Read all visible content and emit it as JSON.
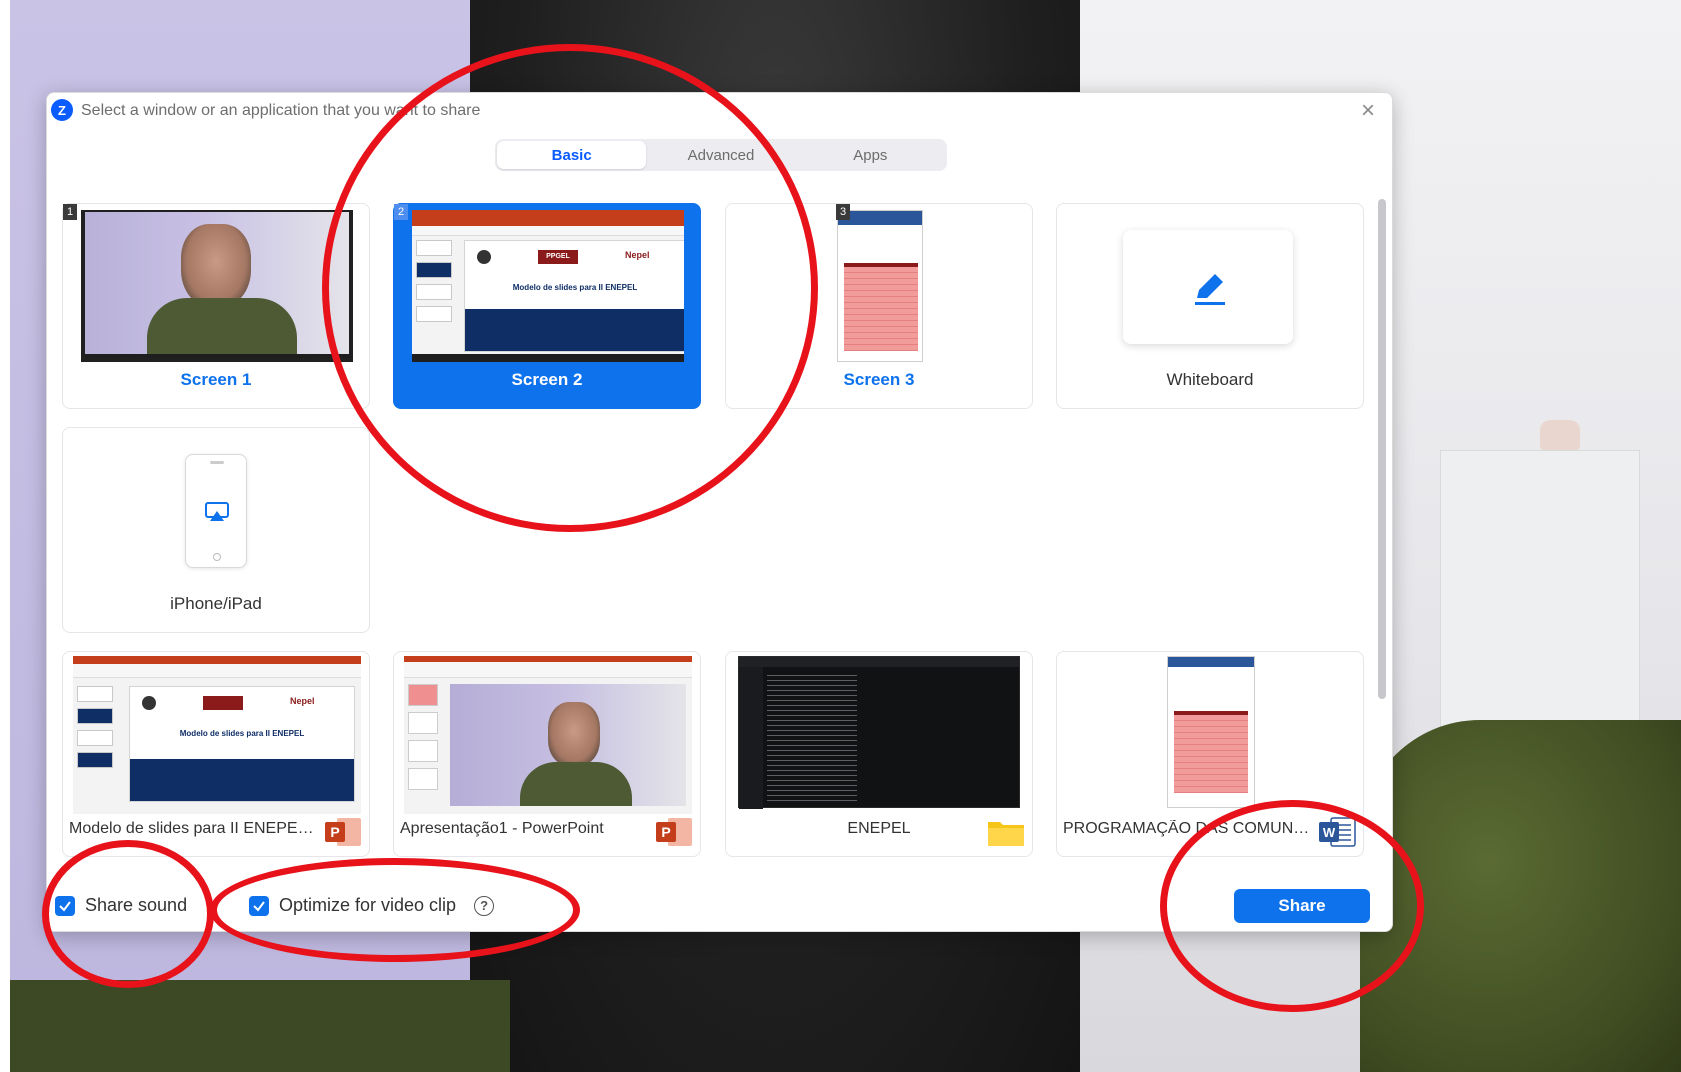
{
  "dialog": {
    "title": "Select a window or an application that you want to share",
    "app_logo": "Z"
  },
  "tabs": [
    {
      "label": "Basic",
      "active": true
    },
    {
      "label": "Advanced",
      "active": false
    },
    {
      "label": "Apps",
      "active": false
    }
  ],
  "screens": [
    {
      "number": "1",
      "label": "Screen 1",
      "selected": false
    },
    {
      "number": "2",
      "label": "Screen 2",
      "selected": true
    },
    {
      "number": "3",
      "label": "Screen 3",
      "selected": false
    },
    {
      "number": "",
      "label": "Whiteboard",
      "selected": false
    },
    {
      "number": "",
      "label": "iPhone/iPad",
      "selected": false
    }
  ],
  "slide_thumb": {
    "headline": "Modelo de slides para II ENEPEL",
    "logo_text": "Nepel",
    "logo_badge": "PPGEL"
  },
  "windows": [
    {
      "label": "Modelo de slides para II ENEPEL....",
      "app_icon": "powerpoint-icon"
    },
    {
      "label": "Apresentação1 - PowerPoint",
      "app_icon": "powerpoint-icon"
    },
    {
      "label": "ENEPEL",
      "app_icon": "folder-icon"
    },
    {
      "label": "PROGRAMAÇÃO DAS COMUNIC...",
      "app_icon": "word-icon"
    }
  ],
  "footer": {
    "share_sound": {
      "label": "Share sound",
      "checked": true
    },
    "optimize": {
      "label": "Optimize for video clip",
      "checked": true
    },
    "help_glyph": "?",
    "share_button": "Share"
  },
  "colors": {
    "accent": "#0e72ed",
    "annotation": "#e8121b"
  }
}
